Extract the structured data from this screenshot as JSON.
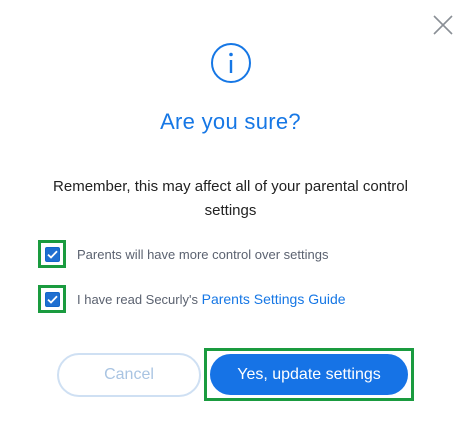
{
  "dialog": {
    "title": "Are you sure?",
    "message": "Remember, this may affect all of your parental control settings",
    "checkboxes": [
      {
        "label": "Parents will have more control over settings",
        "checked": true
      },
      {
        "label_prefix": "I have read Securly's ",
        "link_text": "Parents Settings Guide",
        "checked": true
      }
    ],
    "buttons": {
      "cancel_label": "Cancel",
      "confirm_label": "Yes, update settings"
    },
    "icons": {
      "close": "close-icon",
      "info": "info-icon",
      "check": "checkmark-icon"
    },
    "colors": {
      "accent": "#1677e5",
      "highlight_outline": "#1a9b3f",
      "cancel_text": "#a9c4e2"
    }
  }
}
